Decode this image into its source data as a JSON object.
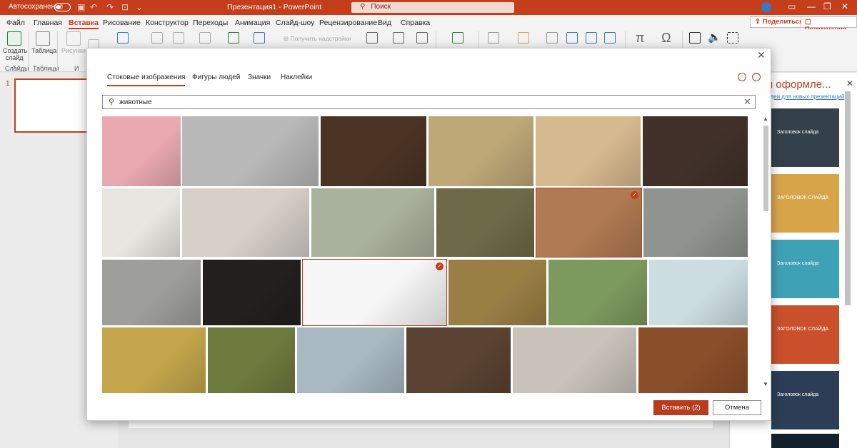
{
  "titlebar": {
    "autosave_label": "Автосохранение",
    "autosave_state": "Откл.",
    "document_title": "Презентация1 - PowerPoint",
    "search_placeholder": "Поиск"
  },
  "menu": {
    "tabs": [
      "Файл",
      "Главная",
      "Вставка",
      "Рисование",
      "Конструктор",
      "Переходы",
      "Анимация",
      "Слайд-шоу",
      "Рецензирование",
      "Вид",
      "Справка"
    ],
    "active_tab": "Вставка",
    "share_label": "Поделиться",
    "comments_label": "Примечания"
  },
  "ribbon": {
    "new_slide_label": "Создать слайд",
    "table_label": "Таблица",
    "pictures_label": "Рисунки",
    "get_addins_label": "Получить надстройки",
    "group_slides": "Слайды",
    "group_tables": "Таблицы",
    "group_partial": "И"
  },
  "slides_pane": {
    "slide_number": "1"
  },
  "design_pane": {
    "title": "я оформле...",
    "link": "идеи для новых презентаций",
    "designs": [
      {
        "text": "Заголовок слайда",
        "color": "#34414b"
      },
      {
        "text": "ЗАГОЛОВОК СЛАЙДА",
        "color": "#d8a44a"
      },
      {
        "text": "Заголовок слайда",
        "color": "#3fa1b6"
      },
      {
        "text": "ЗАГОЛОВОК СЛАЙДА",
        "color": "#c9502b"
      },
      {
        "text": "Заголовок слайда",
        "color": "#2b3e56"
      },
      {
        "text": "",
        "color": "#14202c"
      }
    ]
  },
  "dialog": {
    "tabs": [
      "Стоковые изображения",
      "Фигуры людей",
      "Значки",
      "Наклейки"
    ],
    "active_tab": "Стоковые изображения",
    "search_value": "животные",
    "insert_label": "Вставить (2)",
    "cancel_label": "Отмена",
    "images": [
      {
        "name": "rabbit-on-pink",
        "color": "#e9a9b1",
        "selected": false
      },
      {
        "name": "white-horse",
        "color": "#b9b9b9",
        "selected": false
      },
      {
        "name": "horse-muzzle-dark",
        "color": "#4b3424",
        "selected": false
      },
      {
        "name": "zebras",
        "color": "#bea878",
        "selected": false
      },
      {
        "name": "desert-lizard",
        "color": "#d7b98f",
        "selected": false
      },
      {
        "name": "gorilla-face",
        "color": "#41312a",
        "selected": false
      },
      {
        "name": "cat-peeking",
        "color": "#e8e6e0",
        "selected": false
      },
      {
        "name": "fluffy-cat-looking-up",
        "color": "#d6cfca",
        "selected": false
      },
      {
        "name": "baby-elephant",
        "color": "#a9b29c",
        "selected": false
      },
      {
        "name": "meerkats",
        "color": "#6e6a48",
        "selected": false
      },
      {
        "name": "llama",
        "color": "#b07a52",
        "selected": true
      },
      {
        "name": "cat-behind-car",
        "color": "#8f948e",
        "selected": false
      },
      {
        "name": "gray-cat-profile",
        "color": "#9e9e9c",
        "selected": false
      },
      {
        "name": "leopard-dark",
        "color": "#22201c",
        "selected": false
      },
      {
        "name": "black-dog-peeking",
        "color": "#f7f7f7",
        "selected": true
      },
      {
        "name": "elephants-field",
        "color": "#9a7f45",
        "selected": false
      },
      {
        "name": "kitten-in-grass",
        "color": "#7d9a5e",
        "selected": false
      },
      {
        "name": "kitten-on-blanket",
        "color": "#ccdde2",
        "selected": false
      },
      {
        "name": "cat-yellow-table",
        "color": "#c4a74c",
        "selected": false
      },
      {
        "name": "tigers",
        "color": "#6f7a3e",
        "selected": false
      },
      {
        "name": "birds-sky",
        "color": "#a8b9c2",
        "selected": false
      },
      {
        "name": "horse-rider",
        "color": "#5a4332",
        "selected": false
      },
      {
        "name": "running-horse-legs",
        "color": "#c9c3bb",
        "selected": false
      },
      {
        "name": "service-dog",
        "color": "#8b4e2a",
        "selected": false
      }
    ]
  }
}
